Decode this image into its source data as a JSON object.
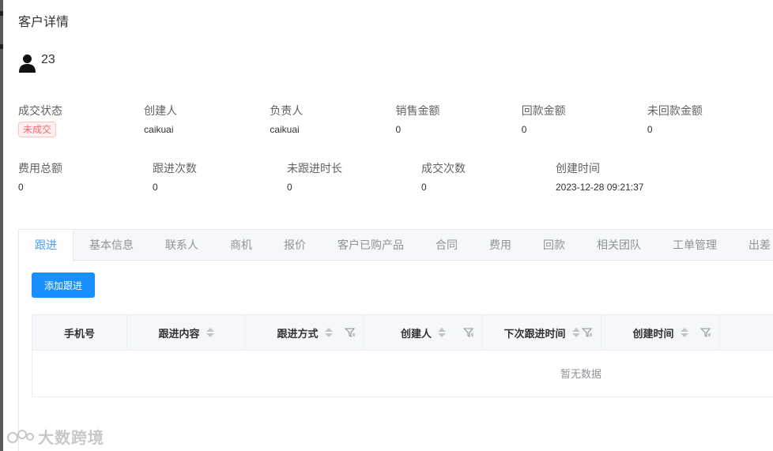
{
  "title": "客户详情",
  "customer": {
    "icon": "user-icon",
    "name": "23"
  },
  "info_rows": [
    [
      {
        "label": "成交状态",
        "value": "未成交",
        "tag": true
      },
      {
        "label": "创建人",
        "value": "caikuai"
      },
      {
        "label": "负责人",
        "value": "caikuai"
      },
      {
        "label": "销售金额",
        "value": "0"
      },
      {
        "label": "回款金额",
        "value": "0"
      },
      {
        "label": "未回款金额",
        "value": "0"
      }
    ],
    [
      {
        "label": "费用总额",
        "value": "0"
      },
      {
        "label": "跟进次数",
        "value": "0"
      },
      {
        "label": "未跟进时长",
        "value": "0"
      },
      {
        "label": "成交次数",
        "value": "0"
      },
      {
        "label": "创建时间",
        "value": "2023-12-28 09:21:37"
      }
    ]
  ],
  "tabs": [
    "跟进",
    "基本信息",
    "联系人",
    "商机",
    "报价",
    "客户已购产品",
    "合同",
    "费用",
    "回款",
    "相关团队",
    "工单管理",
    "出差"
  ],
  "active_tab": "跟进",
  "add_button": "添加跟进",
  "table": {
    "columns": [
      {
        "label": "手机号",
        "sortable": false,
        "filter": false
      },
      {
        "label": "跟进内容",
        "sortable": true,
        "filter": false
      },
      {
        "label": "跟进方式",
        "sortable": true,
        "filter": true
      },
      {
        "label": "创建人",
        "sortable": true,
        "filter": true
      },
      {
        "label": "下次跟进时间",
        "sortable": true,
        "filter": true
      },
      {
        "label": "创建时间",
        "sortable": true,
        "filter": true
      }
    ],
    "empty_text": "暂无数据"
  },
  "watermark": "大数跨境",
  "colors": {
    "primary": "#1890ff",
    "active_tab": "#409eff",
    "danger": "#f56c6c"
  }
}
